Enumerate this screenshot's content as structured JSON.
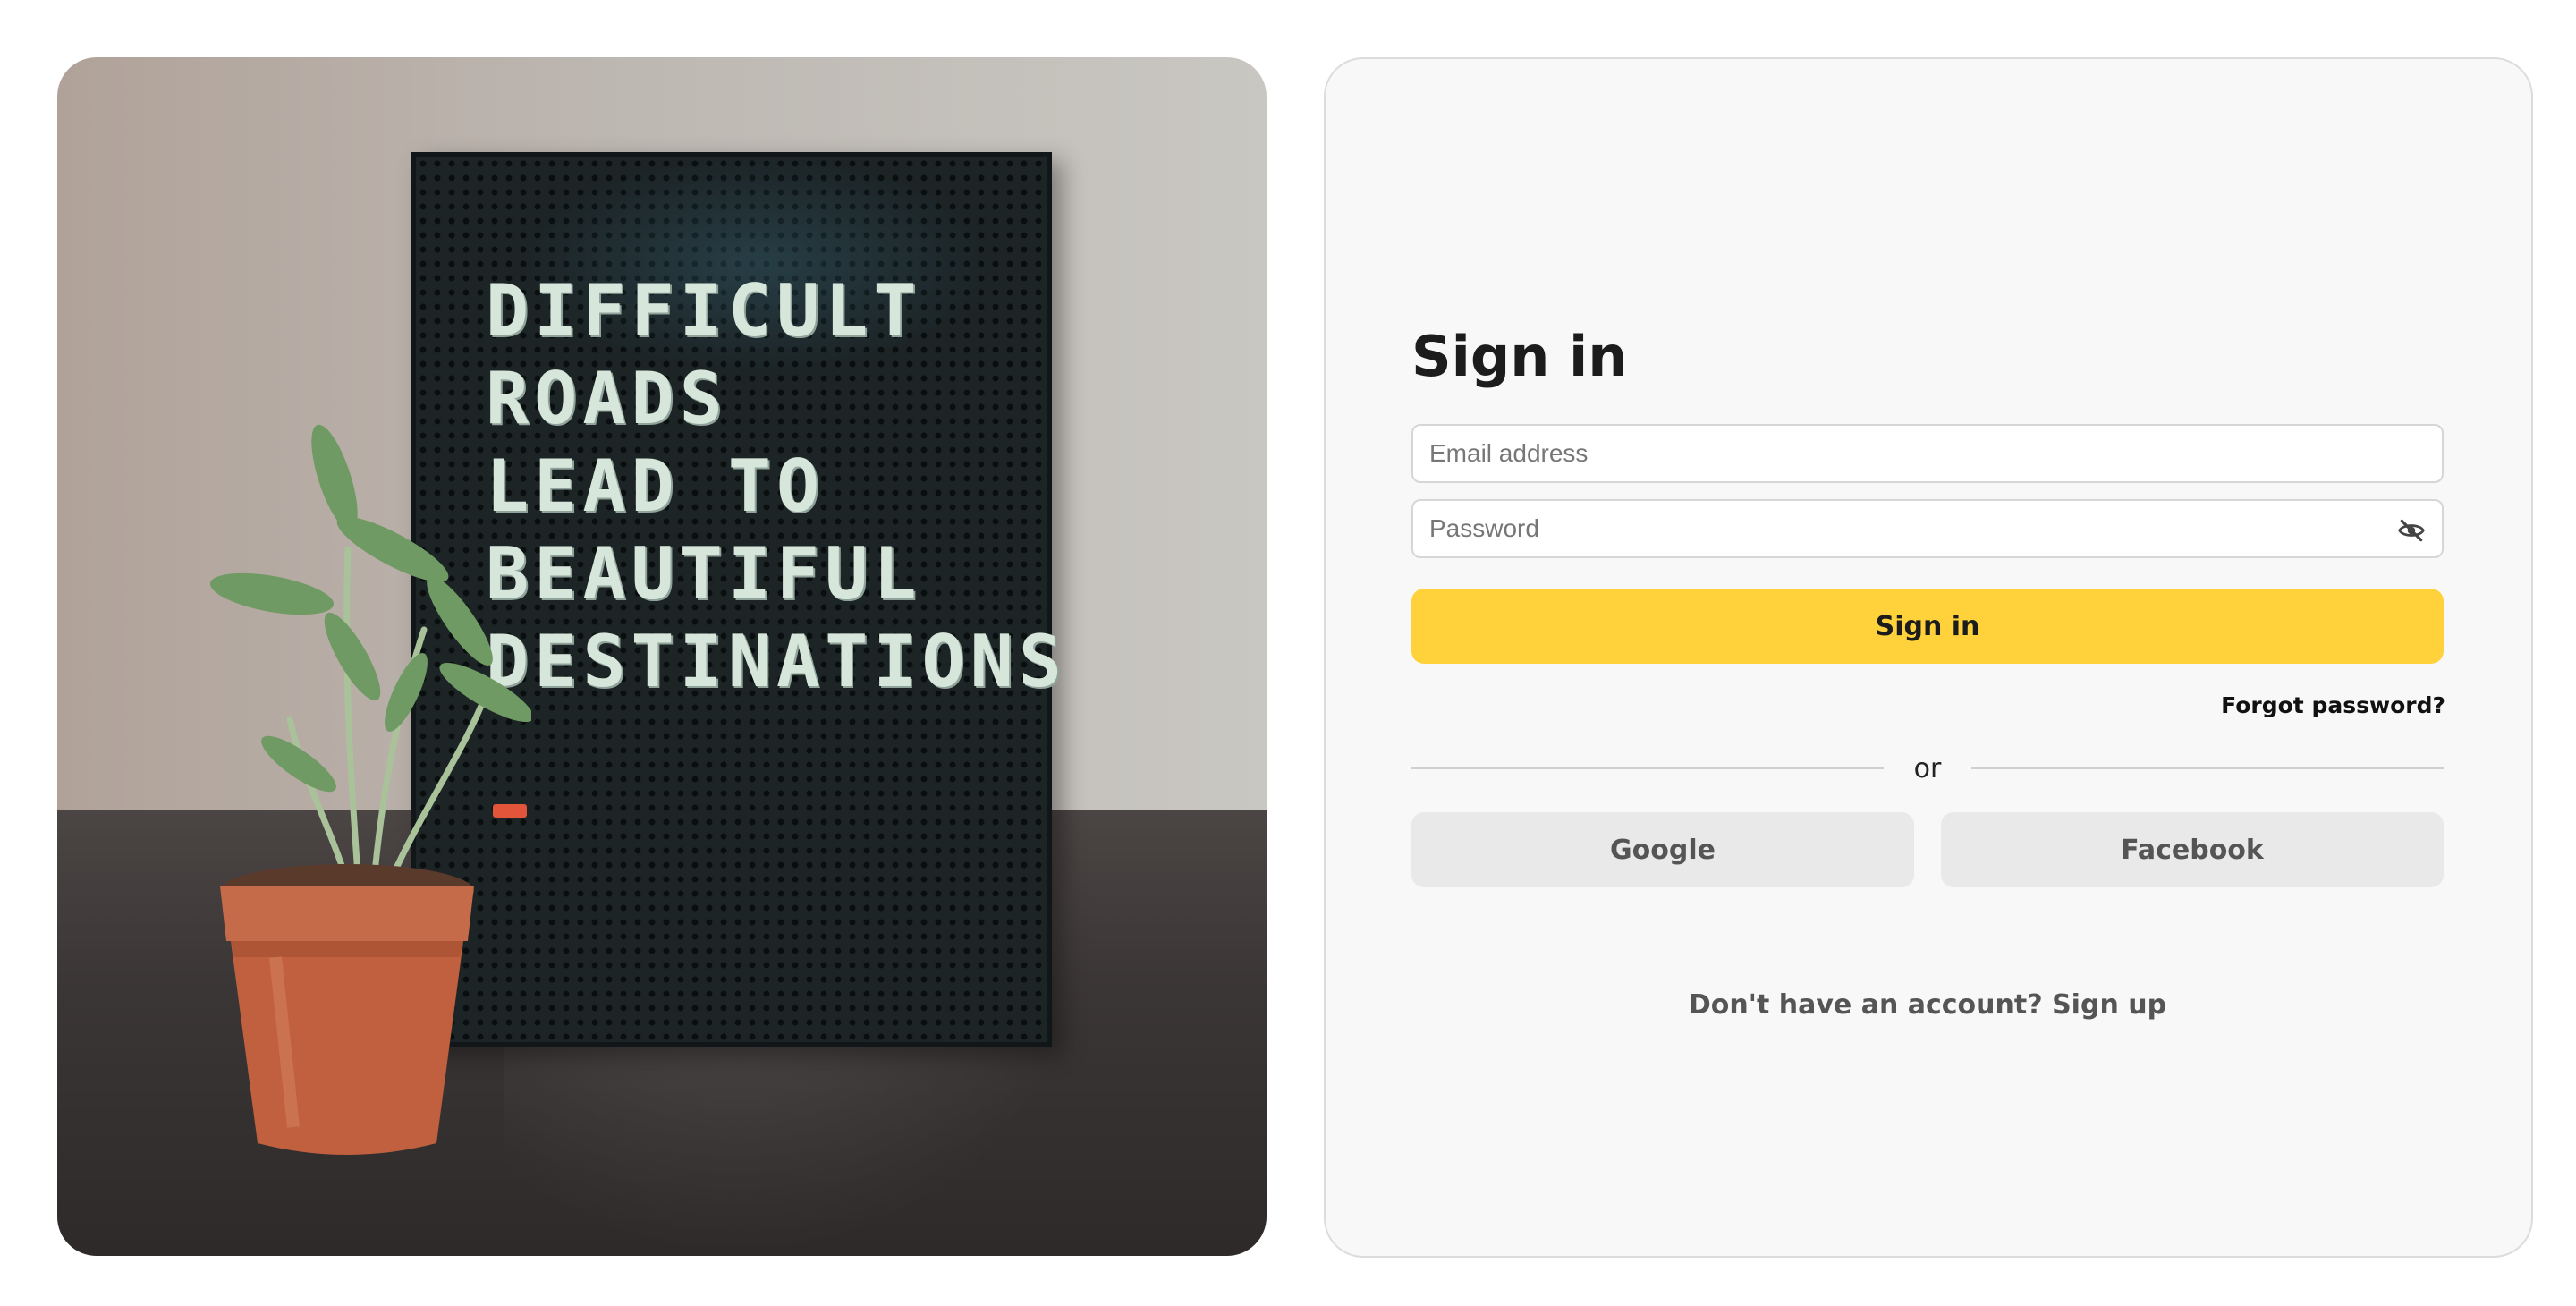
{
  "photo": {
    "board_lines": [
      "DIFFICULT",
      "ROADS",
      "LEAD TO",
      "BEAUTIFUL",
      "DESTINATIONS"
    ]
  },
  "signin": {
    "title": "Sign in",
    "email_placeholder": "Email address",
    "password_placeholder": "Password",
    "submit_label": "Sign in",
    "forgot_label": "Forgot password?",
    "divider_label": "or",
    "google_label": "Google",
    "facebook_label": "Facebook",
    "signup_question": "Don't have an account?",
    "signup_link": "Sign up"
  },
  "colors": {
    "primary_button": "#ffd23c",
    "social_button": "#e9e9e9",
    "card_background": "#f8f8f8"
  },
  "icons": {
    "password_toggle": "eye-slash-icon"
  }
}
